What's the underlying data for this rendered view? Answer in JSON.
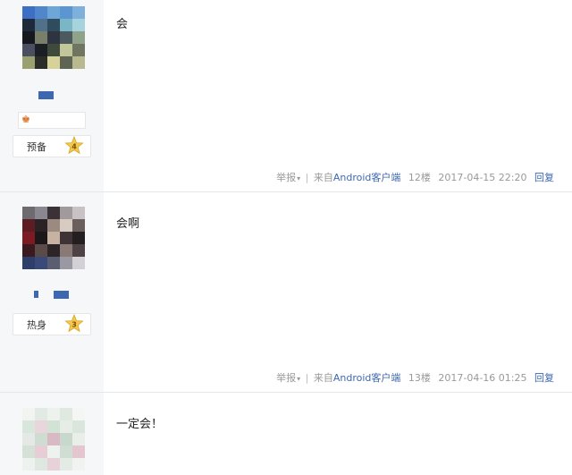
{
  "posts": [
    {
      "message": "会",
      "level_label": "预备",
      "level_num": "4",
      "report_label": "举报",
      "source_prefix": "来自",
      "source_link": "Android客户端",
      "floor": "12楼",
      "timestamp": "2017-04-15 22:20",
      "reply_label": "回复"
    },
    {
      "message": "会啊",
      "level_label": "热身",
      "level_num": "3",
      "report_label": "举报",
      "source_prefix": "来自",
      "source_link": "Android客户端",
      "floor": "13楼",
      "timestamp": "2017-04-16 01:25",
      "reply_label": "回复"
    },
    {
      "message": "一定会！"
    }
  ],
  "colors": {
    "link": "#3d68b1",
    "star": "#f2c94c",
    "sidebar": "#f6f7f9"
  },
  "icons": {
    "report_caret": "▾",
    "badge": "crown-icon"
  }
}
